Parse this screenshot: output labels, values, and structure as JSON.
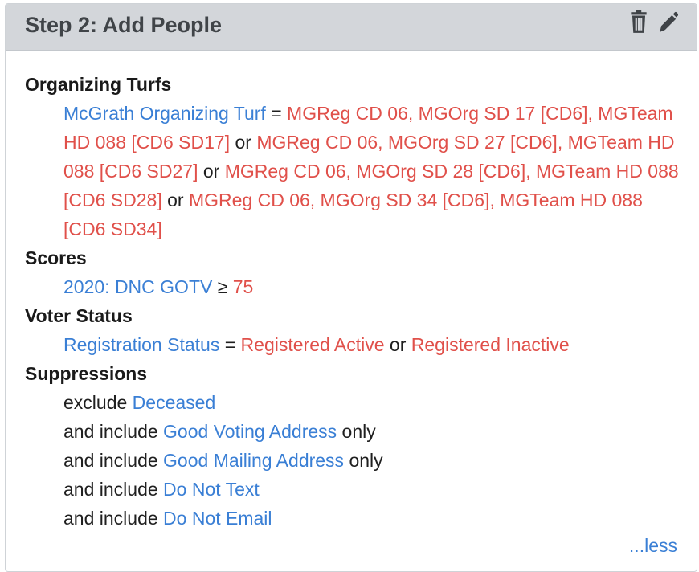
{
  "header": {
    "title": "Step 2: Add People",
    "delete_icon": "trash-icon",
    "edit_icon": "pencil-icon"
  },
  "colors": {
    "link": "#3a7fd5",
    "value": "#e0504a",
    "header_bg": "#d3d6da"
  },
  "sections": {
    "turfs": {
      "title": "Organizing Turfs",
      "field": "McGrath Organizing Turf",
      "op": "=",
      "values": [
        "MGReg CD 06, MGOrg SD 17 [CD6], MGTeam HD 088 [CD6 SD17]",
        "MGReg CD 06, MGOrg SD 27 [CD6], MGTeam HD 088 [CD6 SD27]",
        "MGReg CD 06, MGOrg SD 28 [CD6], MGTeam HD 088 [CD6 SD28]",
        "MGReg CD 06, MGOrg SD 34 [CD6], MGTeam HD 088 [CD6 SD34]"
      ],
      "joiner": "or"
    },
    "scores": {
      "title": "Scores",
      "field": "2020: DNC GOTV",
      "op": "≥",
      "value": "75"
    },
    "voter_status": {
      "title": "Voter Status",
      "field": "Registration Status",
      "op": "=",
      "values": [
        "Registered Active",
        "Registered Inactive"
      ],
      "joiner": "or"
    },
    "suppressions": {
      "title": "Suppressions",
      "rows": [
        {
          "prefix": "exclude",
          "link": "Deceased",
          "suffix": ""
        },
        {
          "prefix": "and include",
          "link": "Good Voting Address",
          "suffix": "only"
        },
        {
          "prefix": "and include",
          "link": "Good Mailing Address",
          "suffix": "only"
        },
        {
          "prefix": "and include",
          "link": "Do Not Text",
          "suffix": ""
        },
        {
          "prefix": "and include",
          "link": "Do Not Email",
          "suffix": ""
        }
      ]
    }
  },
  "less_link": "...less"
}
